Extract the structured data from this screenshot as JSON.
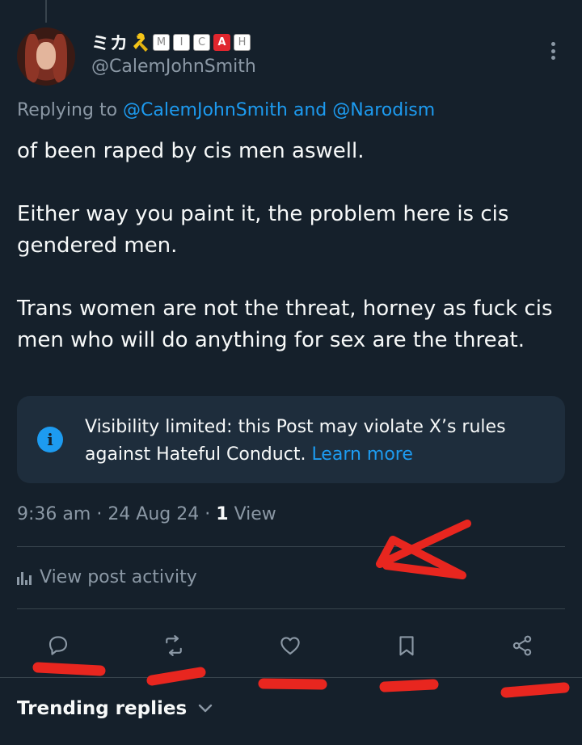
{
  "author": {
    "display_name": "ミカ",
    "name_badges": [
      "M",
      "I",
      "C",
      "A",
      "H"
    ],
    "handle": "@CalemJohnSmith"
  },
  "reply_context": {
    "prefix": "Replying to",
    "mention_1": "@CalemJohnSmith",
    "joiner": "and",
    "mention_2": "@Narodism"
  },
  "post": {
    "paragraphs": [
      "of been raped by cis men aswell.",
      "Either way you paint it, the problem here is cis gendered men.",
      "Trans women are not the threat, horney as fuck cis men who will do anything for sex are the threat."
    ]
  },
  "notice": {
    "text": "Visibility limited: this Post may violate X’s rules against Hateful Conduct.",
    "link": "Learn more"
  },
  "meta": {
    "time": "9:36 am",
    "date": "24 Aug 24",
    "views_count": "1",
    "views_label": "View"
  },
  "activity_label": "View post activity",
  "actions": [
    "reply-icon",
    "repost-icon",
    "like-icon",
    "bookmark-icon",
    "share-icon"
  ],
  "trending_label": "Trending replies",
  "colors": {
    "background": "#15202b",
    "accent": "#1d9bf0",
    "muted": "#8b98a5",
    "annotation": "#e8261f"
  }
}
